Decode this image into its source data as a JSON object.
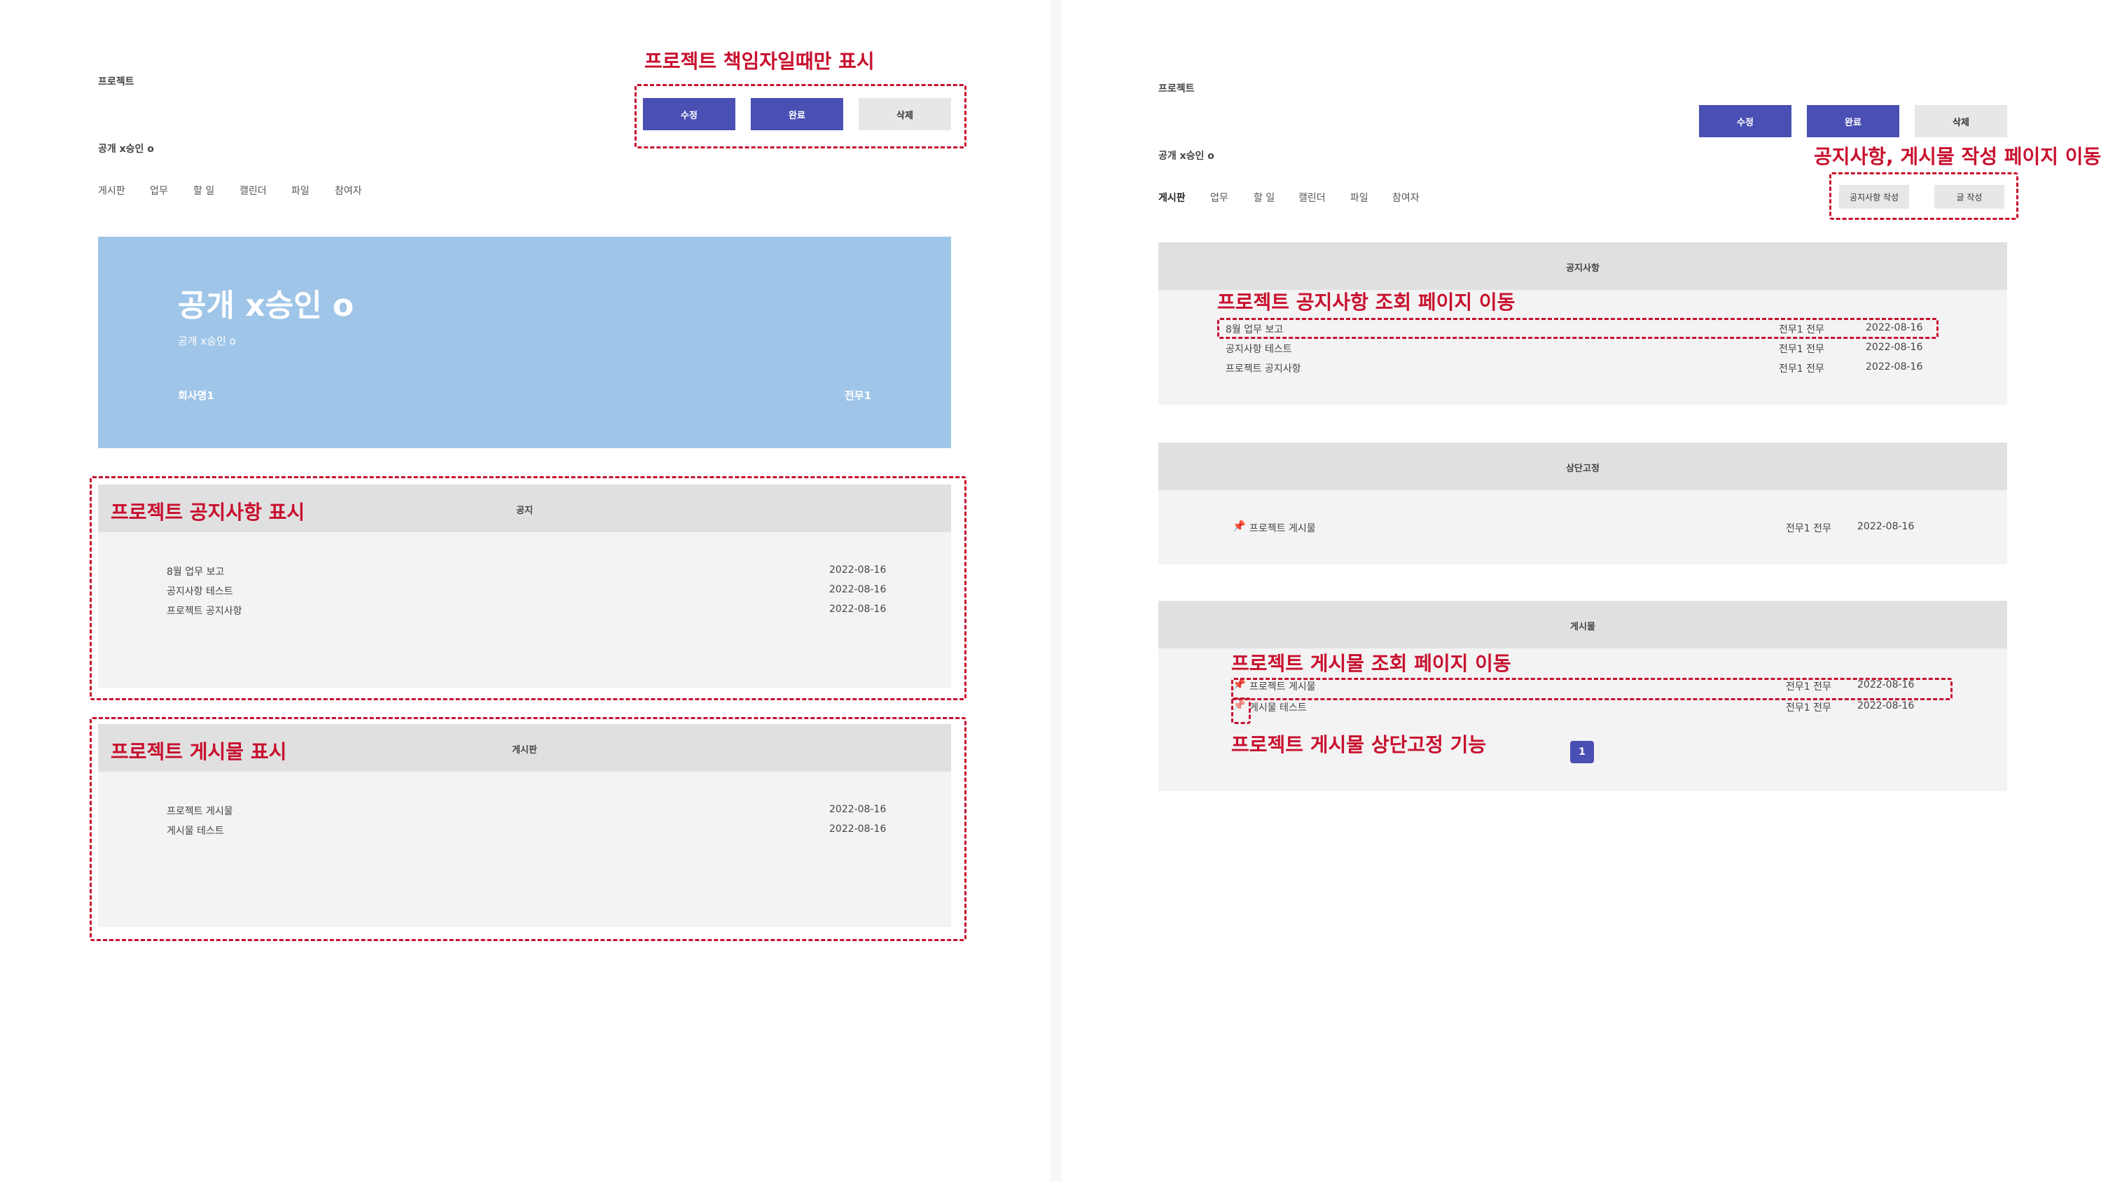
{
  "left": {
    "breadcrumb": "프로젝트",
    "project_name": "공개 x승인 o",
    "tabs": [
      "게시판",
      "업무",
      "할 일",
      "캘린더",
      "파일",
      "참여자"
    ],
    "buttons": {
      "edit": "수정",
      "complete": "완료",
      "delete": "삭제"
    },
    "hero": {
      "title": "공개 x승인 o",
      "subtitle": "공개 x승인 o",
      "company": "회사명1",
      "role": "전무1"
    },
    "notice_section": {
      "title": "공지",
      "rows": [
        {
          "title": "8월 업무 보고",
          "date": "2022-08-16"
        },
        {
          "title": "공지사항 테스트",
          "date": "2022-08-16"
        },
        {
          "title": "프로젝트 공지사항",
          "date": "2022-08-16"
        }
      ]
    },
    "board_section": {
      "title": "게시판",
      "rows": [
        {
          "title": "프로젝트 게시물",
          "date": "2022-08-16"
        },
        {
          "title": "게시물 테스트",
          "date": "2022-08-16"
        }
      ]
    }
  },
  "right": {
    "breadcrumb": "프로젝트",
    "project_name": "공개 x승인 o",
    "tabs": [
      "게시판",
      "업무",
      "할 일",
      "캘린더",
      "파일",
      "참여자"
    ],
    "buttons": {
      "edit": "수정",
      "complete": "완료",
      "delete": "삭제",
      "write_notice": "공지사항 작성",
      "write_post": "글 작성"
    },
    "notice_section": {
      "title": "공지사항",
      "rows": [
        {
          "title": "8월 업무 보고",
          "author": "전무1 전무",
          "date": "2022-08-16"
        },
        {
          "title": "공지사항 테스트",
          "author": "전무1 전무",
          "date": "2022-08-16"
        },
        {
          "title": "프로젝트 공지사항",
          "author": "전무1 전무",
          "date": "2022-08-16"
        }
      ]
    },
    "pinned_section": {
      "title": "상단고정",
      "rows": [
        {
          "title": "프로젝트 게시물",
          "author": "전무1 전무",
          "date": "2022-08-16"
        }
      ]
    },
    "posts_section": {
      "title": "게시물",
      "rows": [
        {
          "title": "프로젝트 게시물",
          "author": "전무1 전무",
          "date": "2022-08-16"
        },
        {
          "title": "게시물 테스트",
          "author": "전무1 전무",
          "date": "2022-08-16"
        }
      ]
    },
    "pagination": {
      "current_page": "1"
    }
  },
  "annotations": {
    "owner_only": "프로젝트 책임자일때만 표시",
    "notice_display": "프로젝트 공지사항 표시",
    "board_display": "프로젝트 게시물 표시",
    "write_pages": "공지사항, 게시물 작성 페이지 이동",
    "notice_view": "프로젝트 공지사항 조회 페이지 이동",
    "post_view": "프로젝트 게시물 조회 페이지 이동",
    "pin_feature": "프로젝트 게시물 상단고정 기능"
  },
  "colors": {
    "primary": "#4a4fb3",
    "hero": "#9fc5e8",
    "annotation": "#c8102e",
    "section_head": "#e0e0e0",
    "section_body": "#f3f3f3"
  },
  "icons": {
    "pin": "pushpin-icon"
  }
}
